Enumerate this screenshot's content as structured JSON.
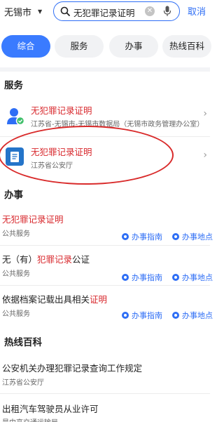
{
  "header": {
    "city": "无锡市",
    "search_value": "无犯罪记录证明",
    "cancel_label": "取消"
  },
  "tabs": [
    {
      "label": "综合"
    },
    {
      "label": "服务"
    },
    {
      "label": "办事"
    },
    {
      "label": "热线百科"
    }
  ],
  "services": {
    "title": "服务",
    "items": [
      {
        "title": "无犯罪记录证明",
        "subtitle": "江苏省-无锡市-无锡市数据局（无锡市政务管理办公室）"
      },
      {
        "title": "无犯罪记录证明",
        "subtitle": "江苏省公安厅"
      }
    ]
  },
  "affairs": {
    "title": "办事",
    "items": [
      {
        "title_pre": "",
        "title_hl": "无犯罪记录证明",
        "title_post": "",
        "category": "公共服务",
        "guide": "办事指南",
        "location": "办事地点"
      },
      {
        "title_pre": "无（有）",
        "title_hl": "犯罪记录",
        "title_post": "公证",
        "category": "公共服务",
        "guide": "办事指南",
        "location": "办事地点"
      },
      {
        "title_pre": "依据档案记载出具相关",
        "title_hl": "证明",
        "title_post": "",
        "category": "公共服务",
        "guide": "办事指南",
        "location": "办事地点"
      }
    ]
  },
  "hotline": {
    "title": "热线百科",
    "items": [
      {
        "title": "公安机关办理犯罪记录查询工作规定",
        "source": "江苏省公安厅"
      },
      {
        "title": "出租汽车驾驶员从业许可",
        "source": "是中高交通运输局"
      }
    ]
  },
  "colors": {
    "accent": "#3a7bff",
    "highlight": "#d8282d",
    "annotation": "#d92b2b"
  }
}
